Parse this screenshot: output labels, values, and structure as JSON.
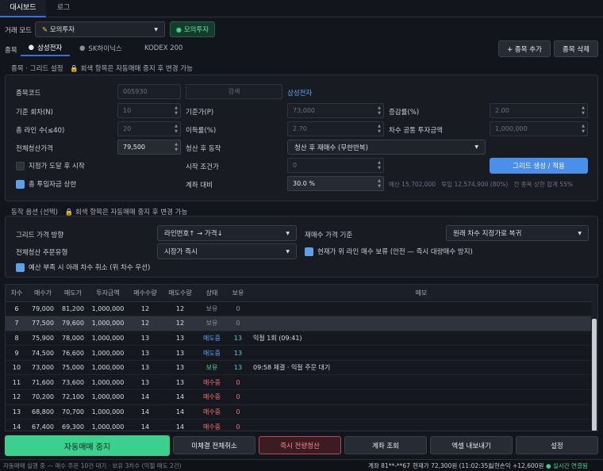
{
  "tabs": [
    {
      "label": "대시보드",
      "active": true
    },
    {
      "label": "로그",
      "active": false
    }
  ],
  "mode": {
    "label": "거래 모드",
    "value": "모의투자",
    "badge": "모의투자"
  },
  "stocks": {
    "label": "종목",
    "tabs": [
      {
        "label": "삼성전자",
        "active": true
      },
      {
        "label": "SK하이닉스",
        "active": false
      },
      {
        "label": "KODEX 200",
        "active": false
      }
    ],
    "add": "+ 종목 추가",
    "remove": "종목 삭제"
  },
  "grid": {
    "title": "종목 · 그리드 설정",
    "lock_note": "회색 항목은 자동매매 중지 후 변경 가능",
    "code_label": "종목코드",
    "code": "005930",
    "search": "검색",
    "stock_name": "삼성전자",
    "f1": {
      "label": "기준 회차(N)",
      "value": "10"
    },
    "f2": {
      "label": "기준가(P)",
      "value": "73,000"
    },
    "f3": {
      "label": "증감률(%)",
      "value": "2.00"
    },
    "f4": {
      "label": "총 라인 수(≤40)",
      "value": "20"
    },
    "f5": {
      "label": "이득률(%)",
      "value": "2.70"
    },
    "f6": {
      "label": "차수 공통 투자금액",
      "value": "1,000,000"
    },
    "f7": {
      "label": "전체청산가격",
      "value": "79,500"
    },
    "f8": {
      "label": "청산 후 동작",
      "value": "청산 후 재매수 (무한반복)"
    },
    "c1": "지정가 도달 후 시작",
    "f9": {
      "label": "시작 조건가",
      "value": "0"
    },
    "apply": "그리드 생성 / 적용",
    "c2": "총 투입자금 상한",
    "f10": {
      "label": "계좌 대비",
      "value": "30.0 %"
    },
    "budget": "예산 15,702,000   투입 12,574,900 (80%)   전 종목 상한 합계 55%"
  },
  "options": {
    "title": "동작 옵션 (선택)",
    "lock_note": "회색 항목은 자동매매 중지 후 변경 가능",
    "dir_label": "그리드 가격 방향",
    "dir_value": "라인번호↑ → 가격↓",
    "rebuy_label": "재매수 가격 기준",
    "rebuy_value": "원래 차수 지정가로 복귀",
    "order_label": "전체청산 주문유형",
    "order_value": "시장가 즉시",
    "c1": "현재가 위 라인 매수 보류 (안전 — 즉시 대량매수 방지)",
    "c2": "예산 부족 시 아래 차수 취소 (위 차수 우선)"
  },
  "table": {
    "headers": [
      "차수",
      "매수가",
      "매도가",
      "투자금액",
      "매수수량",
      "매도수량",
      "상태",
      "보유",
      "메모"
    ],
    "rows": [
      [
        "6",
        "79,000",
        "81,200",
        "1,000,000",
        "12",
        "12",
        "보유",
        "0",
        ""
      ],
      [
        "7",
        "77,500",
        "79,600",
        "1,000,000",
        "12",
        "12",
        "보유",
        "0",
        ""
      ],
      [
        "8",
        "75,900",
        "78,000",
        "1,000,000",
        "13",
        "13",
        "매도중",
        "13",
        "익절 1회 (09:41)"
      ],
      [
        "9",
        "74,500",
        "76,600",
        "1,000,000",
        "13",
        "13",
        "매도중",
        "13",
        ""
      ],
      [
        "10",
        "73,000",
        "75,000",
        "1,000,000",
        "13",
        "13",
        "보유",
        "13",
        "09:58 체결 · 익절 주문 대기"
      ],
      [
        "11",
        "71,600",
        "73,600",
        "1,000,000",
        "13",
        "13",
        "매수중",
        "0",
        ""
      ],
      [
        "12",
        "70,200",
        "72,100",
        "1,000,000",
        "14",
        "14",
        "매수중",
        "0",
        ""
      ],
      [
        "13",
        "68,800",
        "70,700",
        "1,000,000",
        "14",
        "14",
        "매수중",
        "0",
        ""
      ],
      [
        "14",
        "67,400",
        "69,300",
        "1,000,000",
        "14",
        "14",
        "매수중",
        "0",
        ""
      ]
    ]
  },
  "actions": {
    "stop": "자동매매 중지",
    "cancel_all": "미체결 전체취소",
    "liquidate": "즉시 전량청산",
    "account": "계좌 조회",
    "export": "엑셀 내보내기",
    "settings": "설정"
  },
  "status": {
    "left": "자동매매 실행 중 — 매수 주문 10건 대기 · 보유 3차수 (익절 매도 2건)",
    "account": "계좌 81**-**67",
    "price": "현재가 72,300원 (11:02:35)",
    "pnl": "실현손익 +12,600원",
    "conn": "실시간 연결됨"
  }
}
